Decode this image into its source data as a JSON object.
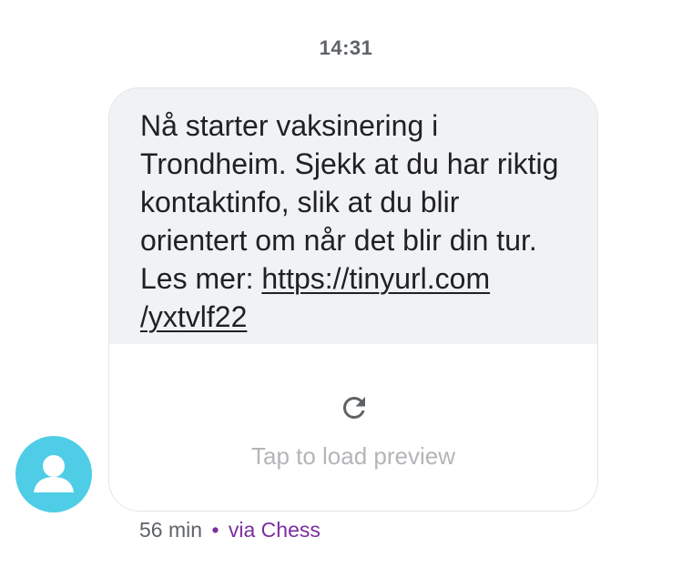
{
  "header": {
    "time": "14:31"
  },
  "message": {
    "text_before_link": "Nå starter vaksinering i Trondheim. Sjekk at du har riktig kontaktinfo, slik at du blir orientert om når det blir din tur. Les mer: ",
    "link_line1": "https://tinyurl.com",
    "link_line2": "/yxtvlf22"
  },
  "preview": {
    "icon": "reload-icon",
    "label": "Tap to load preview"
  },
  "footer": {
    "age": "56 min",
    "separator": "•",
    "via": "via Chess"
  },
  "avatar": {
    "icon": "person-icon",
    "color": "#4fcde6"
  },
  "colors": {
    "bubble_bg": "#f1f2f4",
    "text": "#202124",
    "muted": "#5f6368",
    "via_accent": "#7b2da0"
  }
}
